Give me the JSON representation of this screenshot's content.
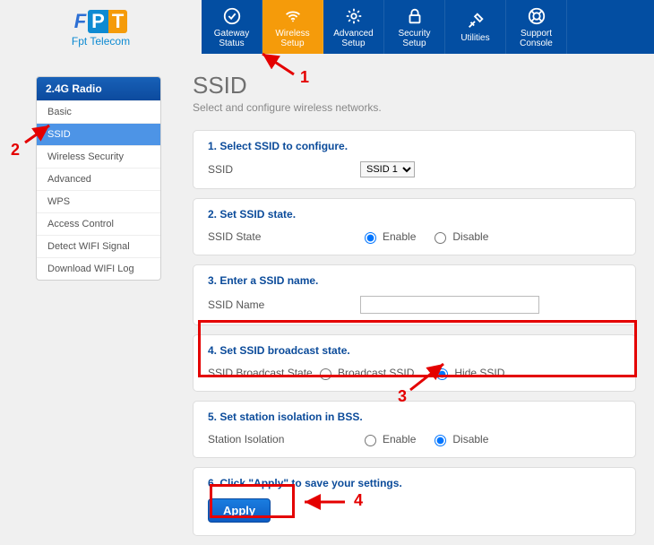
{
  "brand": {
    "f": "F",
    "p": "P",
    "t": "T",
    "tagline": "Fpt Telecom"
  },
  "nav": {
    "items": [
      {
        "line1": "Gateway",
        "line2": "Status"
      },
      {
        "line1": "Wireless",
        "line2": "Setup"
      },
      {
        "line1": "Advanced",
        "line2": "Setup"
      },
      {
        "line1": "Security",
        "line2": "Setup"
      },
      {
        "line1": "Utilities",
        "line2": ""
      },
      {
        "line1": "Support",
        "line2": "Console"
      }
    ]
  },
  "sidebar": {
    "head": "2.4G Radio",
    "items": [
      "Basic",
      "SSID",
      "Wireless Security",
      "Advanced",
      "WPS",
      "Access Control",
      "Detect WIFI Signal",
      "Download WIFI Log"
    ]
  },
  "page": {
    "title": "SSID",
    "desc": "Select and configure wireless networks."
  },
  "cards": {
    "c1": {
      "title": "1. Select SSID to configure.",
      "label": "SSID",
      "selected": "SSID 1"
    },
    "c2": {
      "title": "2. Set SSID state.",
      "label": "SSID State",
      "opt1": "Enable",
      "opt2": "Disable"
    },
    "c3": {
      "title": "3. Enter a SSID name.",
      "label": "SSID Name",
      "value": ""
    },
    "c4": {
      "title": "4. Set SSID broadcast state.",
      "label": "SSID Broadcast State",
      "opt1": "Broadcast SSID",
      "opt2": "Hide SSID"
    },
    "c5": {
      "title": "5. Set station isolation in BSS.",
      "label": "Station Isolation",
      "opt1": "Enable",
      "opt2": "Disable"
    },
    "c6": {
      "title": "6. Click \"Apply\" to save your settings.",
      "button": "Apply"
    }
  },
  "annotations": {
    "n1": "1",
    "n2": "2",
    "n3": "3",
    "n4": "4"
  }
}
